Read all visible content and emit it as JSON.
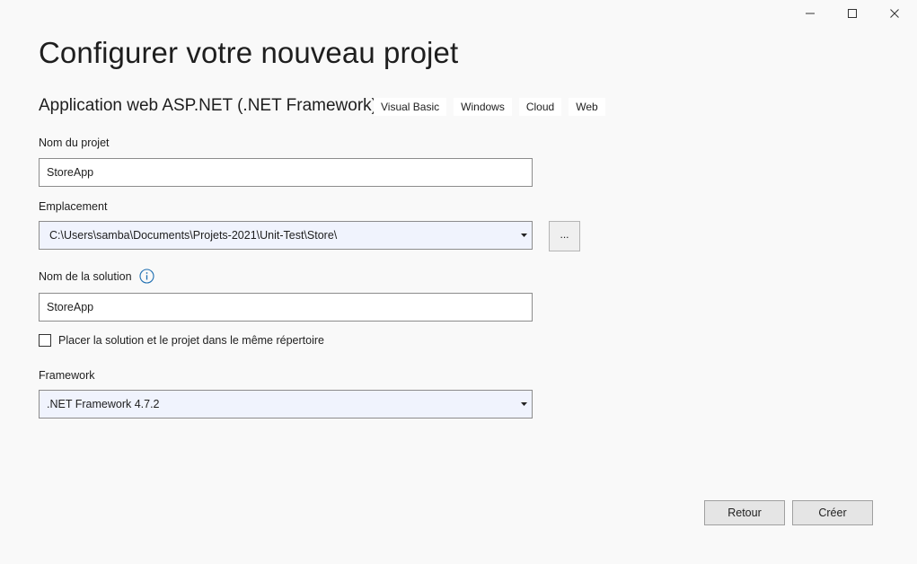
{
  "window": {
    "minimize_icon": "minimize-icon",
    "maximize_icon": "maximize-icon",
    "close_icon": "close-icon"
  },
  "title": "Configurer votre nouveau projet",
  "template": {
    "name": "Application web ASP.NET (.NET Framework)",
    "tags": [
      "Visual Basic",
      "Windows",
      "Cloud",
      "Web"
    ]
  },
  "form": {
    "project_name_label": "Nom du projet",
    "project_name_value": "StoreApp",
    "location_label": "Emplacement",
    "location_value": "C:\\Users\\samba\\Documents\\Projets-2021\\Unit-Test\\Store\\",
    "browse_label": "...",
    "solution_name_label": "Nom de la solution",
    "solution_name_value": "StoreApp",
    "same_dir_label": "Placer la solution et le projet dans le même répertoire",
    "same_dir_checked": false,
    "framework_label": "Framework",
    "framework_value": ".NET Framework 4.7.2"
  },
  "buttons": {
    "back": "Retour",
    "create": "Créer"
  },
  "colors": {
    "background": "#f9f9f9",
    "combo_fill": "#f0f3fd",
    "info_icon": "#1f6fb2"
  }
}
